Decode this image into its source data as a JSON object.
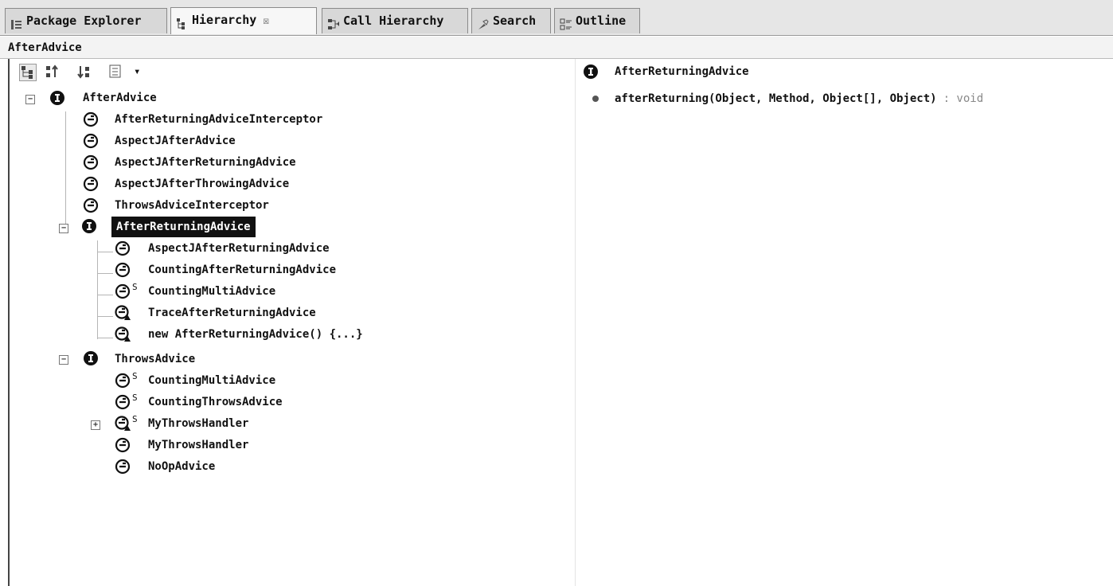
{
  "tabs": [
    {
      "label": "Package Explorer",
      "icon": "package-explorer-icon",
      "active": false
    },
    {
      "label": "Hierarchy",
      "icon": "hierarchy-icon",
      "active": true,
      "close": "☒"
    },
    {
      "label": "Call Hierarchy",
      "icon": "call-hierarchy-icon",
      "active": false
    },
    {
      "label": "Search",
      "icon": "search-icon",
      "active": false
    },
    {
      "label": "Outline",
      "icon": "outline-icon",
      "active": false
    }
  ],
  "focus_label": "AfterAdvice",
  "toolbar": {
    "buttons": [
      "type-hierarchy-icon",
      "supertype-hierarchy-icon",
      "subtype-hierarchy-icon",
      "layout-menu-icon"
    ],
    "dropdown": "▾"
  },
  "tree": {
    "root": {
      "label": "AfterAdvice",
      "kind": "interface"
    },
    "level1": [
      {
        "label": "AfterReturningAdviceInterceptor",
        "kind": "class"
      },
      {
        "label": "AspectJAfterAdvice",
        "kind": "class"
      },
      {
        "label": "AspectJAfterReturningAdvice",
        "kind": "class"
      },
      {
        "label": "AspectJAfterThrowingAdvice",
        "kind": "class"
      },
      {
        "label": "ThrowsAdviceInterceptor",
        "kind": "class"
      },
      {
        "label": "AfterReturningAdvice",
        "kind": "interface",
        "selected": true
      },
      {
        "label": "ThrowsAdvice",
        "kind": "interface"
      }
    ],
    "after_returning_children": [
      {
        "label": "AspectJAfterReturningAdvice",
        "kind": "class"
      },
      {
        "label": "CountingAfterReturningAdvice",
        "kind": "class"
      },
      {
        "label": "CountingMultiAdvice",
        "kind": "class",
        "sup": "S"
      },
      {
        "label": "TraceAfterReturningAdvice",
        "kind": "class-local"
      },
      {
        "label": "new AfterReturningAdvice() {...}",
        "kind": "class-anon"
      }
    ],
    "throws_children": [
      {
        "label": "CountingMultiAdvice",
        "kind": "class",
        "sup": "S"
      },
      {
        "label": "CountingThrowsAdvice",
        "kind": "class",
        "sup": "S"
      },
      {
        "label": "MyThrowsHandler",
        "kind": "class-local",
        "sup": "S",
        "collapsed": true
      },
      {
        "label": "MyThrowsHandler",
        "kind": "class"
      },
      {
        "label": "NoOpAdvice",
        "kind": "class"
      }
    ]
  },
  "member_panel": {
    "header": {
      "label": "AfterReturningAdvice",
      "kind": "interface"
    },
    "methods": [
      {
        "signature": "afterReturning(Object, Method, Object[], Object)",
        "return": ": void"
      }
    ]
  },
  "colors": {
    "selection_bg": "#111111",
    "selection_fg": "#ffffff",
    "tab_active": "#f7f7f7"
  }
}
